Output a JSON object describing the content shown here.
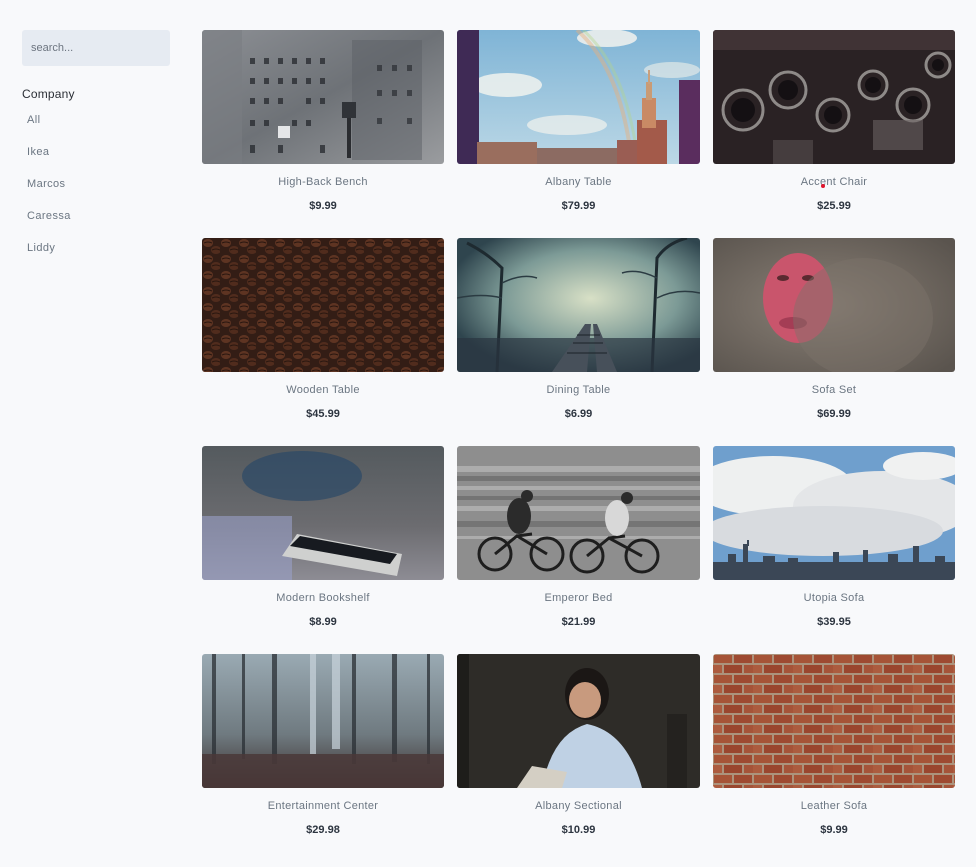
{
  "search": {
    "placeholder": "search..."
  },
  "filters": {
    "heading": "Company",
    "items": [
      "All",
      "Ikea",
      "Marcos",
      "Caressa",
      "Liddy"
    ]
  },
  "products": [
    {
      "name": "High-Back Bench",
      "price": "$9.99"
    },
    {
      "name": "Albany Table",
      "price": "$79.99"
    },
    {
      "name": "Accent Chair",
      "price": "$25.99"
    },
    {
      "name": "Wooden Table",
      "price": "$45.99"
    },
    {
      "name": "Dining Table",
      "price": "$6.99"
    },
    {
      "name": "Sofa Set",
      "price": "$69.99"
    },
    {
      "name": "Modern Bookshelf",
      "price": "$8.99"
    },
    {
      "name": "Emperor Bed",
      "price": "$21.99"
    },
    {
      "name": "Utopia Sofa",
      "price": "$39.95"
    },
    {
      "name": "Entertainment Center",
      "price": "$29.98"
    },
    {
      "name": "Albany Sectional",
      "price": "$10.99"
    },
    {
      "name": "Leather Sofa",
      "price": "$9.99"
    }
  ]
}
